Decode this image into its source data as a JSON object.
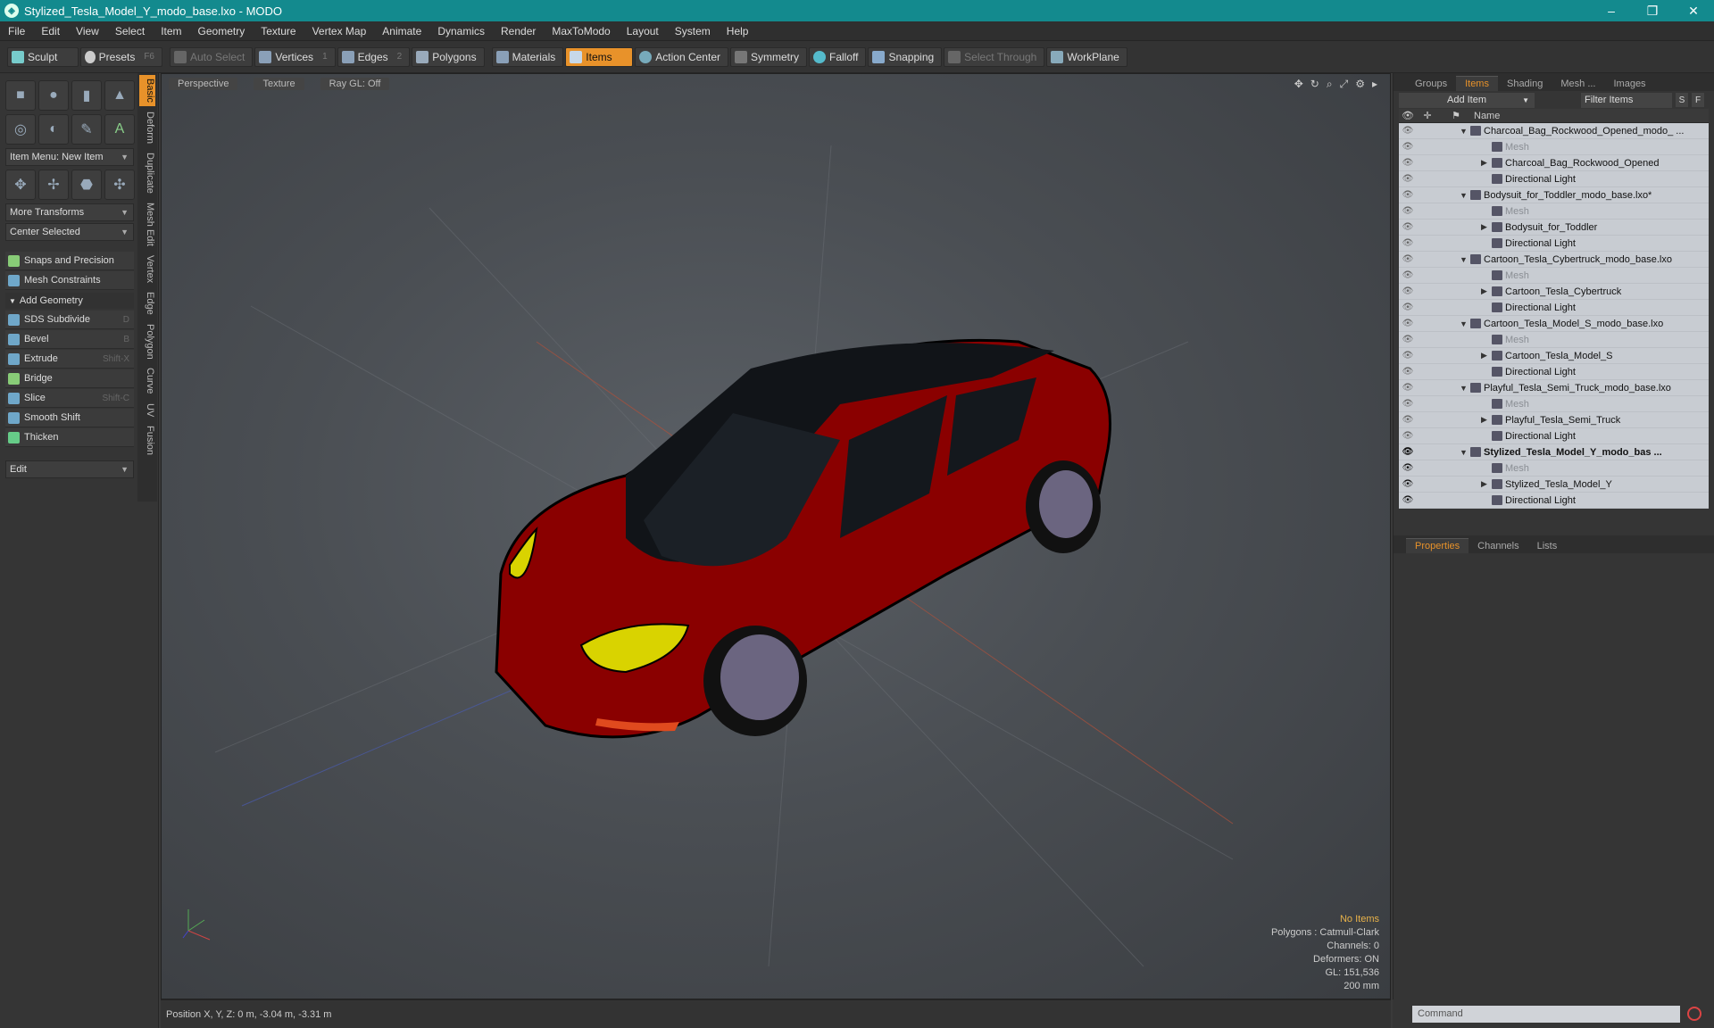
{
  "window": {
    "title": "Stylized_Tesla_Model_Y_modo_base.lxo - MODO",
    "controls": [
      "–",
      "❐",
      "✕"
    ]
  },
  "menu": [
    "File",
    "Edit",
    "View",
    "Select",
    "Item",
    "Geometry",
    "Texture",
    "Vertex Map",
    "Animate",
    "Dynamics",
    "Render",
    "MaxToModo",
    "Layout",
    "System",
    "Help"
  ],
  "toolbar": {
    "sculpt": "Sculpt",
    "presets": "Presets",
    "presets_key": "F6",
    "auto_select": "Auto Select",
    "vertices": "Vertices",
    "vertices_key": "1",
    "edges": "Edges",
    "edges_key": "2",
    "polygons": "Polygons",
    "materials": "Materials",
    "items": "Items",
    "action_center": "Action Center",
    "symmetry": "Symmetry",
    "falloff": "Falloff",
    "snapping": "Snapping",
    "select_through": "Select Through",
    "workplane": "WorkPlane"
  },
  "left": {
    "vtabs": [
      "Basic",
      "Deform",
      "Duplicate",
      "Mesh Edit",
      "Vertex",
      "Edge",
      "Polygon",
      "Curve",
      "UV",
      "Fusion"
    ],
    "item_menu": "Item Menu: New Item",
    "more_transforms": "More Transforms",
    "center_selected": "Center Selected",
    "snaps": "Snaps and Precision",
    "mesh_constraints": "Mesh Constraints",
    "add_geometry": "Add Geometry",
    "tools": [
      {
        "label": "SDS Subdivide",
        "key": "D"
      },
      {
        "label": "Bevel",
        "key": "B"
      },
      {
        "label": "Extrude",
        "key": "Shift-X"
      },
      {
        "label": "Bridge",
        "key": ""
      },
      {
        "label": "Slice",
        "key": "Shift-C"
      },
      {
        "label": "Smooth Shift",
        "key": ""
      },
      {
        "label": "Thicken",
        "key": ""
      }
    ],
    "edit": "Edit"
  },
  "viewport": {
    "view": "Perspective",
    "shading": "Texture",
    "raygl": "Ray GL: Off",
    "stats": {
      "items": "No Items",
      "polygons": "Polygons : Catmull-Clark",
      "channels": "Channels: 0",
      "deformers": "Deformers: ON",
      "gl": "GL: 151,536",
      "scale": "200 mm"
    },
    "car_color": "#8a0000",
    "headlight_color": "#d9d300"
  },
  "status": {
    "position": "Position X, Y, Z:   0 m, -3.04 m, -3.31 m"
  },
  "right": {
    "tabs": [
      "Groups",
      "Items",
      "Shading",
      "Mesh ...",
      "Images"
    ],
    "add_item": "Add Item",
    "filter": "Filter Items",
    "s": "S",
    "f": "F",
    "name_col": "Name",
    "tree": [
      {
        "label": "Charcoal_Bag_Rockwood_Opened_modo_ ...",
        "level": 0
      },
      {
        "label": "Mesh",
        "level": 1,
        "dim": true
      },
      {
        "label": "Charcoal_Bag_Rockwood_Opened",
        "level": 1
      },
      {
        "label": "Directional Light",
        "level": 1
      },
      {
        "label": "Bodysuit_for_Toddler_modo_base.lxo*",
        "level": 0
      },
      {
        "label": "Mesh",
        "level": 1,
        "dim": true
      },
      {
        "label": "Bodysuit_for_Toddler",
        "level": 1
      },
      {
        "label": "Directional Light",
        "level": 1
      },
      {
        "label": "Cartoon_Tesla_Cybertruck_modo_base.lxo",
        "level": 0
      },
      {
        "label": "Mesh",
        "level": 1,
        "dim": true
      },
      {
        "label": "Cartoon_Tesla_Cybertruck",
        "level": 1
      },
      {
        "label": "Directional Light",
        "level": 1
      },
      {
        "label": "Cartoon_Tesla_Model_S_modo_base.lxo",
        "level": 0
      },
      {
        "label": "Mesh",
        "level": 1,
        "dim": true
      },
      {
        "label": "Cartoon_Tesla_Model_S",
        "level": 1
      },
      {
        "label": "Directional Light",
        "level": 1
      },
      {
        "label": "Playful_Tesla_Semi_Truck_modo_base.lxo",
        "level": 0
      },
      {
        "label": "Mesh",
        "level": 1,
        "dim": true
      },
      {
        "label": "Playful_Tesla_Semi_Truck",
        "level": 1
      },
      {
        "label": "Directional Light",
        "level": 1
      },
      {
        "label": "Stylized_Tesla_Model_Y_modo_bas ...",
        "level": 0,
        "bold": true
      },
      {
        "label": "Mesh",
        "level": 1,
        "dim": true
      },
      {
        "label": "Stylized_Tesla_Model_Y",
        "level": 1
      },
      {
        "label": "Directional Light",
        "level": 1
      }
    ],
    "prop_tabs": [
      "Properties",
      "Channels",
      "Lists"
    ],
    "command": "Command"
  }
}
